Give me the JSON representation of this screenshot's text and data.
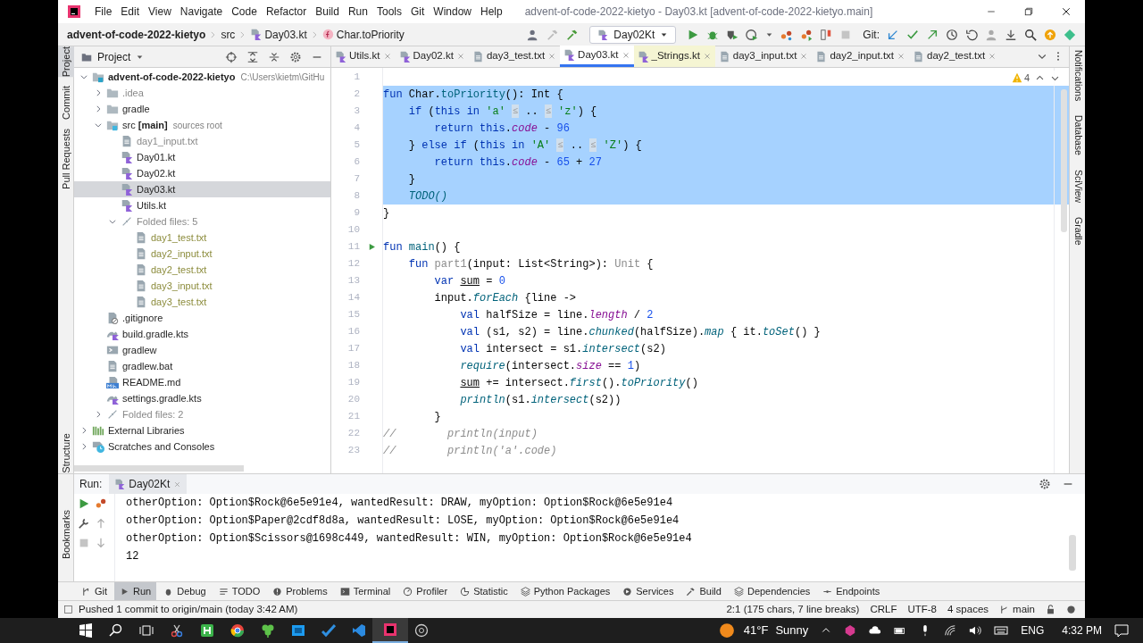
{
  "window": {
    "title": "advent-of-code-2022-kietyo - Day03.kt [advent-of-code-2022-kietyo.main]"
  },
  "menu": [
    "File",
    "Edit",
    "View",
    "Navigate",
    "Code",
    "Refactor",
    "Build",
    "Run",
    "Tools",
    "Git",
    "Window",
    "Help"
  ],
  "breadcrumbs": [
    {
      "label": "advent-of-code-2022-kietyo",
      "kind": "project"
    },
    {
      "label": "src",
      "kind": "folder"
    },
    {
      "label": "Day03.kt",
      "kind": "kotlin"
    },
    {
      "label": "Char.toPriority",
      "kind": "function"
    }
  ],
  "run_config": "Day02Kt",
  "vcs_label": "Git:",
  "left_stripe": {
    "top": [
      {
        "label": "Project",
        "selected": true
      },
      {
        "label": "Commit",
        "selected": false
      },
      {
        "label": "Pull Requests",
        "selected": false
      }
    ],
    "bottom": [
      {
        "label": "Structure",
        "selected": false
      },
      {
        "label": "Bookmarks",
        "selected": false
      }
    ]
  },
  "project_panel": {
    "title": "Project",
    "tree": [
      {
        "label": "advent-of-code-2022-kietyo",
        "kind": "module",
        "dimmed": false,
        "ignored": false,
        "hint": "C:\\Users\\kietm\\GitHu",
        "expanded": true,
        "selected": false,
        "children": [
          {
            "label": ".idea",
            "kind": "folder",
            "dimmed": true,
            "ignored": false,
            "expanded": false,
            "selected": false
          },
          {
            "label": "gradle",
            "kind": "folder",
            "dimmed": false,
            "ignored": false,
            "expanded": false,
            "selected": false
          },
          {
            "label": "src **[main]**",
            "kind": "source",
            "dimmed": false,
            "ignored": false,
            "hint": "sources root",
            "expanded": true,
            "selected": false,
            "children": [
              {
                "label": "day1_input.txt",
                "kind": "text",
                "dimmed": true,
                "ignored": false,
                "selected": false
              },
              {
                "label": "Day01.kt",
                "kind": "kotlin",
                "dimmed": false,
                "ignored": false,
                "selected": false
              },
              {
                "label": "Day02.kt",
                "kind": "kotlin",
                "dimmed": false,
                "ignored": false,
                "selected": false
              },
              {
                "label": "Day03.kt",
                "kind": "kotlin",
                "dimmed": false,
                "ignored": false,
                "selected": true
              },
              {
                "label": "Utils.kt",
                "kind": "kotlin",
                "dimmed": false,
                "ignored": false,
                "selected": false
              },
              {
                "label": "Folded files: 5",
                "kind": "folded",
                "dimmed": true,
                "ignored": false,
                "expanded": true,
                "selected": false,
                "children": [
                  {
                    "label": "day1_test.txt",
                    "kind": "text",
                    "dimmed": false,
                    "ignored": true,
                    "selected": false
                  },
                  {
                    "label": "day2_input.txt",
                    "kind": "text",
                    "dimmed": false,
                    "ignored": true,
                    "selected": false
                  },
                  {
                    "label": "day2_test.txt",
                    "kind": "text",
                    "dimmed": false,
                    "ignored": true,
                    "selected": false
                  },
                  {
                    "label": "day3_input.txt",
                    "kind": "text",
                    "dimmed": false,
                    "ignored": true,
                    "selected": false
                  },
                  {
                    "label": "day3_test.txt",
                    "kind": "text",
                    "dimmed": false,
                    "ignored": true,
                    "selected": false
                  }
                ]
              }
            ]
          },
          {
            "label": ".gitignore",
            "kind": "gitignore",
            "dimmed": false,
            "ignored": false,
            "selected": false
          },
          {
            "label": "build.gradle.kts",
            "kind": "gradle",
            "dimmed": false,
            "ignored": false,
            "selected": false
          },
          {
            "label": "gradlew",
            "kind": "script",
            "dimmed": false,
            "ignored": false,
            "selected": false
          },
          {
            "label": "gradlew.bat",
            "kind": "text",
            "dimmed": false,
            "ignored": false,
            "selected": false
          },
          {
            "label": "README.md",
            "kind": "markdown",
            "dimmed": false,
            "ignored": false,
            "selected": false
          },
          {
            "label": "settings.gradle.kts",
            "kind": "gradle",
            "dimmed": false,
            "ignored": false,
            "selected": false
          },
          {
            "label": "Folded files: 2",
            "kind": "folded",
            "dimmed": true,
            "ignored": false,
            "expanded": false,
            "selected": false
          }
        ]
      },
      {
        "label": "External Libraries",
        "kind": "libraries",
        "dimmed": false,
        "ignored": false,
        "expanded": false,
        "selected": false
      },
      {
        "label": "Scratches and Consoles",
        "kind": "scratches",
        "dimmed": false,
        "ignored": false,
        "expanded": false,
        "selected": false
      }
    ]
  },
  "editor_tabs": [
    {
      "label": "Utils.kt",
      "kind": "kotlin",
      "selected": false,
      "highlighted": false
    },
    {
      "label": "Day02.kt",
      "kind": "kotlin",
      "selected": false,
      "highlighted": false
    },
    {
      "label": "day3_test.txt",
      "kind": "text",
      "selected": false,
      "highlighted": false
    },
    {
      "label": "Day03.kt",
      "kind": "kotlin",
      "selected": true,
      "highlighted": false
    },
    {
      "label": "_Strings.kt",
      "kind": "kotlin",
      "selected": false,
      "highlighted": true
    },
    {
      "label": "day3_input.txt",
      "kind": "text",
      "selected": false,
      "highlighted": false
    },
    {
      "label": "day2_input.txt",
      "kind": "text",
      "selected": false,
      "highlighted": false
    },
    {
      "label": "day2_test.txt",
      "kind": "text",
      "selected": false,
      "highlighted": false
    }
  ],
  "editor": {
    "warnings": "4",
    "lines": [
      {
        "number": "1",
        "selected": false
      },
      {
        "number": "2",
        "selected": true,
        "tokens": [
          {
            "kind": "keyword",
            "text": "fun"
          },
          {
            "kind": "plain",
            "text": " Char."
          },
          {
            "kind": "function",
            "text": "toPriority"
          },
          {
            "kind": "plain",
            "text": "(): Int {"
          }
        ]
      },
      {
        "number": "3",
        "selected": true,
        "tokens": [
          {
            "kind": "keyword",
            "text": "    if"
          },
          {
            "kind": "plain",
            "text": " ("
          },
          {
            "kind": "keyword",
            "text": "this in"
          },
          {
            "kind": "string",
            "text": " 'a' "
          },
          {
            "kind": "hint",
            "text": "≤"
          },
          {
            "kind": "plain",
            "text": " .. "
          },
          {
            "kind": "hint",
            "text": "≤"
          },
          {
            "kind": "string",
            "text": " 'z'"
          },
          {
            "kind": "plain",
            "text": ") {"
          }
        ]
      },
      {
        "number": "4",
        "selected": true,
        "tokens": [
          {
            "kind": "keyword",
            "text": "        return this"
          },
          {
            "kind": "plain",
            "text": "."
          },
          {
            "kind": "property",
            "text": "code"
          },
          {
            "kind": "plain",
            "text": " - "
          },
          {
            "kind": "number",
            "text": "96"
          }
        ]
      },
      {
        "number": "5",
        "selected": true,
        "tokens": [
          {
            "kind": "plain",
            "text": "    }"
          },
          {
            "kind": "keyword",
            "text": " else if"
          },
          {
            "kind": "plain",
            "text": " ("
          },
          {
            "kind": "keyword",
            "text": "this in"
          },
          {
            "kind": "string",
            "text": " 'A' "
          },
          {
            "kind": "hint",
            "text": "≤"
          },
          {
            "kind": "plain",
            "text": " .. "
          },
          {
            "kind": "hint",
            "text": "≤"
          },
          {
            "kind": "string",
            "text": " 'Z'"
          },
          {
            "kind": "plain",
            "text": ") {"
          }
        ]
      },
      {
        "number": "6",
        "selected": true,
        "tokens": [
          {
            "kind": "keyword",
            "text": "        return this"
          },
          {
            "kind": "plain",
            "text": "."
          },
          {
            "kind": "property",
            "text": "code"
          },
          {
            "kind": "plain",
            "text": " - "
          },
          {
            "kind": "number",
            "text": "65"
          },
          {
            "kind": "plain",
            "text": " + "
          },
          {
            "kind": "number",
            "text": "27"
          }
        ]
      },
      {
        "number": "7",
        "selected": true,
        "tokens": [
          {
            "kind": "plain",
            "text": "    }"
          }
        ]
      },
      {
        "number": "8",
        "selected": true,
        "tokens": [
          {
            "kind": "call",
            "text": "    TODO()"
          }
        ]
      },
      {
        "number": "9",
        "selected": false,
        "tokens": [
          {
            "kind": "plain",
            "text": "}"
          }
        ]
      },
      {
        "number": "10",
        "selected": false
      },
      {
        "number": "11",
        "selected": false,
        "run": true,
        "tokens": [
          {
            "kind": "keyword",
            "text": "fun"
          },
          {
            "kind": "function",
            "text": " main"
          },
          {
            "kind": "plain",
            "text": "() {"
          }
        ]
      },
      {
        "number": "12",
        "selected": false,
        "tokens": [
          {
            "kind": "keyword",
            "text": "    fun"
          },
          {
            "kind": "unused",
            "text": " part1"
          },
          {
            "kind": "plain",
            "text": "(input: List<String>): "
          },
          {
            "kind": "unused",
            "text": "Unit"
          },
          {
            "kind": "plain",
            "text": " {"
          }
        ]
      },
      {
        "number": "13",
        "selected": false,
        "tokens": [
          {
            "kind": "keyword",
            "text": "        var "
          },
          {
            "kind": "variable",
            "text": "sum"
          },
          {
            "kind": "plain",
            "text": " = "
          },
          {
            "kind": "number",
            "text": "0"
          }
        ]
      },
      {
        "number": "14",
        "selected": false,
        "tokens": [
          {
            "kind": "plain",
            "text": "        input."
          },
          {
            "kind": "call",
            "text": "forEach"
          },
          {
            "kind": "plain",
            "text": " {line ->"
          }
        ]
      },
      {
        "number": "15",
        "selected": false,
        "tokens": [
          {
            "kind": "keyword",
            "text": "            val"
          },
          {
            "kind": "plain",
            "text": " halfSize = line."
          },
          {
            "kind": "property",
            "text": "length"
          },
          {
            "kind": "plain",
            "text": " / "
          },
          {
            "kind": "number",
            "text": "2"
          }
        ]
      },
      {
        "number": "16",
        "selected": false,
        "tokens": [
          {
            "kind": "keyword",
            "text": "            val"
          },
          {
            "kind": "plain",
            "text": " (s1, s2) = line."
          },
          {
            "kind": "call",
            "text": "chunked"
          },
          {
            "kind": "plain",
            "text": "(halfSize)."
          },
          {
            "kind": "call",
            "text": "map"
          },
          {
            "kind": "plain",
            "text": " { it."
          },
          {
            "kind": "call",
            "text": "toSet"
          },
          {
            "kind": "plain",
            "text": "() }"
          }
        ]
      },
      {
        "number": "17",
        "selected": false,
        "tokens": [
          {
            "kind": "keyword",
            "text": "            val"
          },
          {
            "kind": "plain",
            "text": " intersect = s1."
          },
          {
            "kind": "call",
            "text": "intersect"
          },
          {
            "kind": "plain",
            "text": "(s2)"
          }
        ]
      },
      {
        "number": "18",
        "selected": false,
        "tokens": [
          {
            "kind": "call",
            "text": "            require"
          },
          {
            "kind": "plain",
            "text": "(intersect."
          },
          {
            "kind": "property",
            "text": "size"
          },
          {
            "kind": "plain",
            "text": " == "
          },
          {
            "kind": "number",
            "text": "1"
          },
          {
            "kind": "plain",
            "text": ")"
          }
        ]
      },
      {
        "number": "19",
        "selected": false,
        "tokens": [
          {
            "kind": "variable",
            "text": "            sum"
          },
          {
            "kind": "plain",
            "text": " += intersect."
          },
          {
            "kind": "call",
            "text": "first"
          },
          {
            "kind": "plain",
            "text": "()."
          },
          {
            "kind": "call",
            "text": "toPriority"
          },
          {
            "kind": "plain",
            "text": "()"
          }
        ]
      },
      {
        "number": "20",
        "selected": false,
        "tokens": [
          {
            "kind": "call",
            "text": "            println"
          },
          {
            "kind": "plain",
            "text": "(s1."
          },
          {
            "kind": "call",
            "text": "intersect"
          },
          {
            "kind": "plain",
            "text": "(s2))"
          }
        ]
      },
      {
        "number": "21",
        "selected": false,
        "tokens": [
          {
            "kind": "plain",
            "text": "        }"
          }
        ]
      },
      {
        "number": "22",
        "selected": false,
        "tokens": [
          {
            "kind": "comment",
            "text": "//        println(input)"
          }
        ]
      },
      {
        "number": "23",
        "selected": false,
        "tokens": [
          {
            "kind": "comment",
            "text": "//        println('a'.code)"
          }
        ]
      }
    ]
  },
  "right_stripe": [
    "Notifications",
    "Database",
    "SciView",
    "Gradle"
  ],
  "run_panel": {
    "label": "Run:",
    "tab": "Day02Kt",
    "output": [
      "otherOption: Option$Rock@6e5e91e4, wantedResult: DRAW, myOption: Option$Rock@6e5e91e4",
      "otherOption: Option$Paper@2cdf8d8a, wantedResult: LOSE, myOption: Option$Rock@6e5e91e4",
      "otherOption: Option$Scissors@1698c449, wantedResult: WIN, myOption: Option$Rock@6e5e91e4",
      "12"
    ]
  },
  "tool_tabs": [
    {
      "label": "Git",
      "selected": false
    },
    {
      "label": "Run",
      "selected": true
    },
    {
      "label": "Debug",
      "selected": false
    },
    {
      "label": "TODO",
      "selected": false
    },
    {
      "label": "Problems",
      "selected": false
    },
    {
      "label": "Terminal",
      "selected": false
    },
    {
      "label": "Profiler",
      "selected": false
    },
    {
      "label": "Statistic",
      "selected": false
    },
    {
      "label": "Python Packages",
      "selected": false
    },
    {
      "label": "Services",
      "selected": false
    },
    {
      "label": "Build",
      "selected": false
    },
    {
      "label": "Dependencies",
      "selected": false
    },
    {
      "label": "Endpoints",
      "selected": false
    }
  ],
  "status_bar": {
    "message": "Pushed 1 commit to origin/main (today 3:42 AM)",
    "items": [
      "2:1 (175 chars, 7 line breaks)",
      "CRLF",
      "UTF-8",
      "4 spaces",
      "main"
    ]
  },
  "taskbar": {
    "temperature": "41°F",
    "weather": "Sunny",
    "language": "ENG",
    "time": "4:32 PM"
  }
}
